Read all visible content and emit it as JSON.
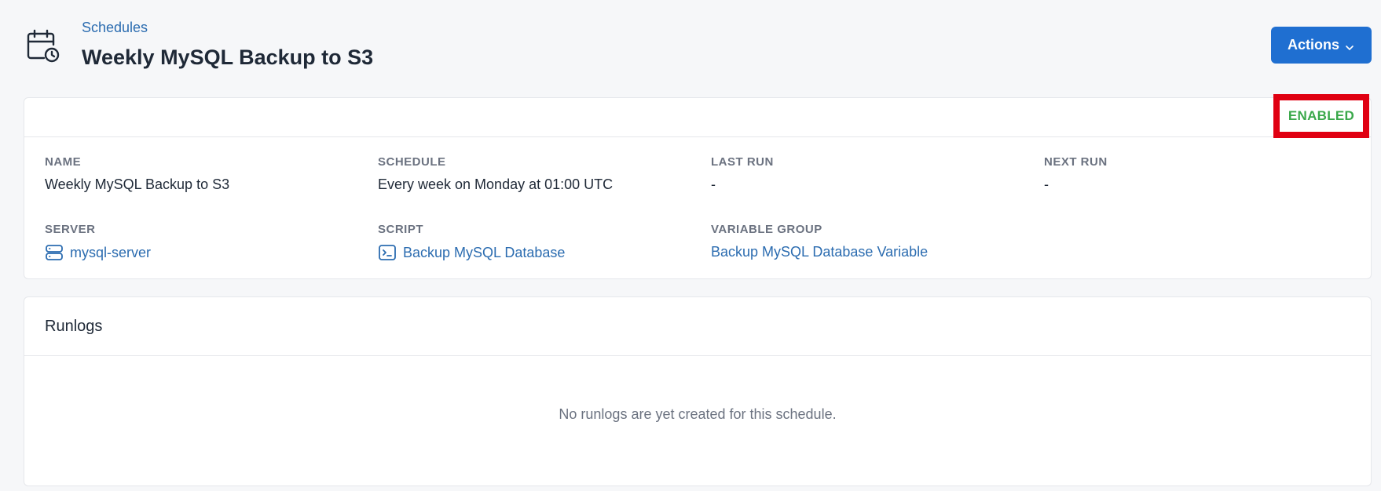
{
  "header": {
    "breadcrumb": "Schedules",
    "title": "Weekly MySQL Backup to S3",
    "actions_label": "Actions",
    "icon": "calendar-clock-icon"
  },
  "details": {
    "status": "ENABLED",
    "fields": {
      "name": {
        "label": "NAME",
        "value": "Weekly MySQL Backup to S3"
      },
      "schedule": {
        "label": "SCHEDULE",
        "value": "Every week on Monday at 01:00 UTC"
      },
      "last_run": {
        "label": "LAST RUN",
        "value": "-"
      },
      "next_run": {
        "label": "NEXT RUN",
        "value": "-"
      },
      "server": {
        "label": "SERVER",
        "value": "mysql-server",
        "icon": "server-icon"
      },
      "script": {
        "label": "SCRIPT",
        "value": "Backup MySQL Database",
        "icon": "terminal-icon"
      },
      "variable_group": {
        "label": "VARIABLE GROUP",
        "value": "Backup MySQL Database Variable"
      }
    }
  },
  "runlogs": {
    "title": "Runlogs",
    "empty_message": "No runlogs are yet created for this schedule."
  },
  "colors": {
    "accent": "#1f6fd1",
    "link": "#2b6cb0",
    "status_enabled": "#3aa84a",
    "highlight": "#e00012"
  }
}
